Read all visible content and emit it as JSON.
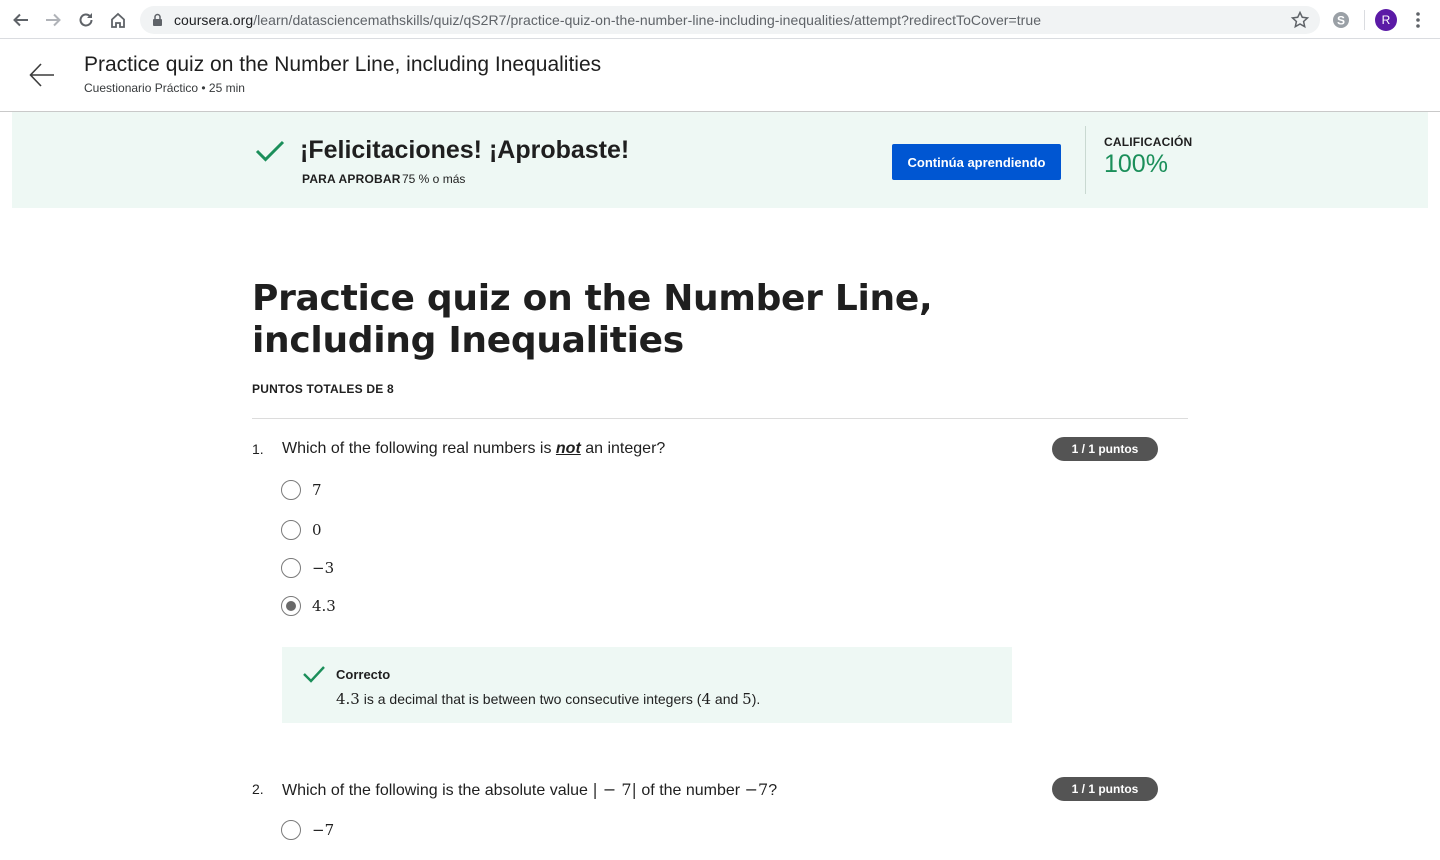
{
  "browser": {
    "url_host": "coursera.org",
    "url_path": "/learn/datasciencemathskills/quiz/qS2R7/practice-quiz-on-the-number-line-including-inequalities/attempt?redirectToCover=true",
    "avatar_letter": "R"
  },
  "header": {
    "title": "Practice quiz on the Number Line, including Inequalities",
    "subtitle": "Cuestionario Práctico • 25 min"
  },
  "banner": {
    "title": "¡Felicitaciones! ¡Aprobaste!",
    "pass_label": "PARA APROBAR",
    "pass_value": "75 % o más",
    "continue_label": "Continúa aprendiendo",
    "grade_label": "CALIFICACIÓN",
    "grade_value": "100%",
    "accent_color": "#1b8f5a",
    "button_color": "#0056d2"
  },
  "quiz": {
    "title": "Practice quiz on the Number Line, including Inequalities",
    "total_points": "PUNTOS TOTALES DE 8",
    "questions": [
      {
        "number": "1.",
        "text_before": "Which of the following real numbers is",
        "text_emphasis": "not",
        "text_after": "an integer?",
        "points": "1 / 1 puntos",
        "options": [
          {
            "label": "7",
            "selected": false
          },
          {
            "label": "0",
            "selected": false
          },
          {
            "label": "−3",
            "selected": false
          },
          {
            "label": "4.3",
            "selected": true
          }
        ],
        "feedback": {
          "title": "Correcto",
          "math": "4.3",
          "text_a": "is a decimal that is between two consecutive integers (",
          "math_b": "4",
          "text_b": "and",
          "math_c": "5",
          "text_c": ")."
        }
      },
      {
        "number": "2.",
        "text_before": "Which of the following is the absolute value",
        "math_abs": "| − 7|",
        "text_mid": "of the number",
        "math_num": "−7",
        "text_after": "?",
        "points": "1 / 1 puntos",
        "options": [
          {
            "label": "−7",
            "selected": false
          }
        ]
      }
    ]
  }
}
